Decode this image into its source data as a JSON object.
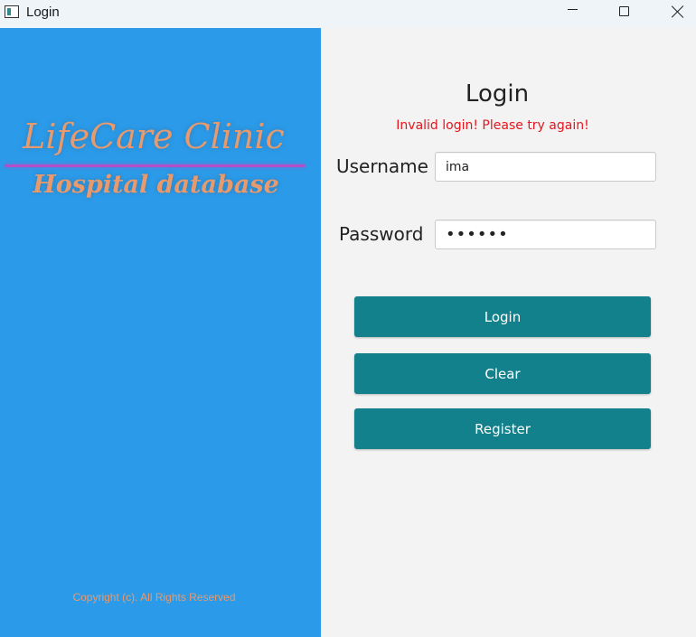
{
  "window": {
    "title": "Login",
    "icon": "app-window-icon",
    "controls": [
      "minimize-icon",
      "maximize-icon",
      "close-icon"
    ]
  },
  "brand": {
    "title": "LifeCare Clinic",
    "subtitle": "Hospital database",
    "copyright": "Copyright (c). All Rights Reserved",
    "colors": {
      "panel_background": "#2b9be9",
      "text": "#e69a6e",
      "divider": "#b04fc8"
    }
  },
  "form": {
    "title": "Login",
    "error_message": "Invalid login! Please try again!",
    "error_color": "#e3171d",
    "username_label": "Username",
    "username_value": "ima",
    "password_label": "Password",
    "password_value": "••••••",
    "buttons": {
      "login": "Login",
      "clear": "Clear",
      "register": "Register"
    },
    "button_color": "#13818c"
  }
}
